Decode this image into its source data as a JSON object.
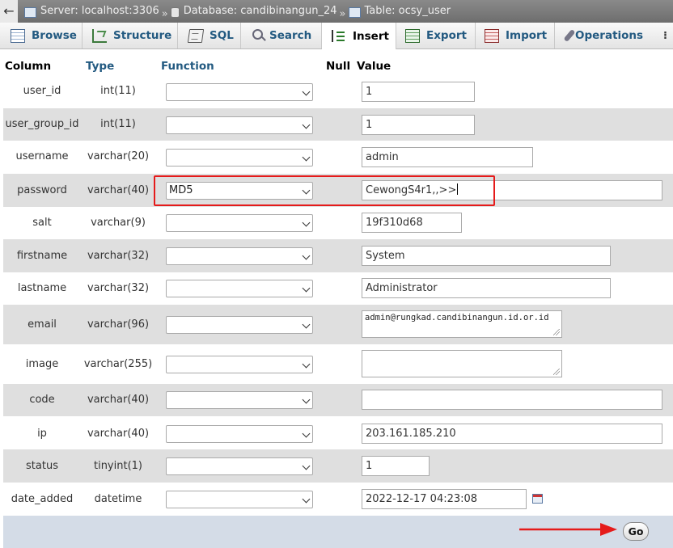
{
  "breadcrumb": {
    "back_label": "←",
    "server": "Server: localhost:3306",
    "database": "Database: candibinangun_24",
    "table": "Table: ocsy_user",
    "separator": "»"
  },
  "tabs": [
    {
      "label": "Browse",
      "icon": "browse-icon"
    },
    {
      "label": "Structure",
      "icon": "structure-icon"
    },
    {
      "label": "SQL",
      "icon": "sql-icon"
    },
    {
      "label": "Search",
      "icon": "search-icon"
    },
    {
      "label": "Insert",
      "icon": "insert-icon",
      "active": true
    },
    {
      "label": "Export",
      "icon": "export-icon"
    },
    {
      "label": "Import",
      "icon": "import-icon"
    },
    {
      "label": "Operations",
      "icon": "operations-icon"
    }
  ],
  "table_header": {
    "column": "Column",
    "type": "Type",
    "function": "Function",
    "null": "Null",
    "value": "Value"
  },
  "rows": [
    {
      "name": "user_id",
      "type": "int(11)",
      "function": "",
      "value": "1"
    },
    {
      "name": "user_group_id",
      "type": "int(11)",
      "function": "",
      "value": "1"
    },
    {
      "name": "username",
      "type": "varchar(20)",
      "function": "",
      "value": "admin"
    },
    {
      "name": "password",
      "type": "varchar(40)",
      "function": "MD5",
      "value": "CewongS4r1,,>>"
    },
    {
      "name": "salt",
      "type": "varchar(9)",
      "function": "",
      "value": "19f310d68"
    },
    {
      "name": "firstname",
      "type": "varchar(32)",
      "function": "",
      "value": "System"
    },
    {
      "name": "lastname",
      "type": "varchar(32)",
      "function": "",
      "value": "Administrator"
    },
    {
      "name": "email",
      "type": "varchar(96)",
      "function": "",
      "value": "admin@rungkad.candibinangun.id.or.id"
    },
    {
      "name": "image",
      "type": "varchar(255)",
      "function": "",
      "value": ""
    },
    {
      "name": "code",
      "type": "varchar(40)",
      "function": "",
      "value": ""
    },
    {
      "name": "ip",
      "type": "varchar(40)",
      "function": "",
      "value": "203.161.185.210"
    },
    {
      "name": "status",
      "type": "tinyint(1)",
      "function": "",
      "value": "1"
    },
    {
      "name": "date_added",
      "type": "datetime",
      "function": "",
      "value": "2022-12-17 04:23:08"
    }
  ],
  "footer": {
    "go_label": "Go"
  },
  "colors": {
    "highlight": "#e51b1b",
    "tab_text": "#235a81",
    "footer_bg": "#d4dce7"
  }
}
